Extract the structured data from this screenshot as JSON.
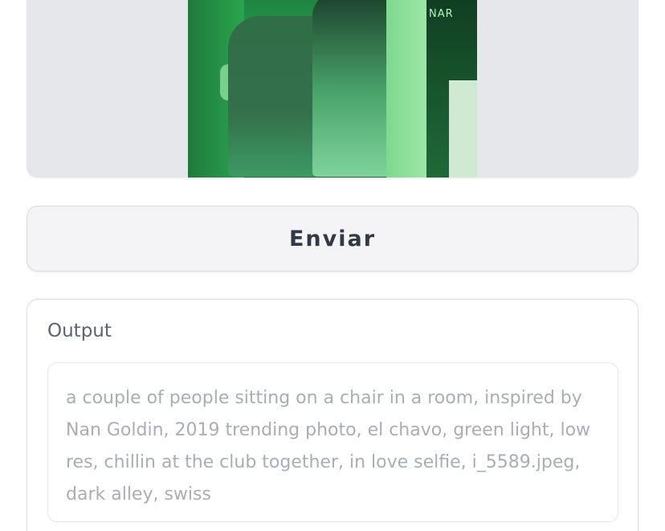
{
  "image": {
    "sign_text": "NAR"
  },
  "submit_button": {
    "label": "Enviar"
  },
  "output": {
    "label": "Output",
    "text": "a couple of people sitting on a chair in a room, inspired by Nan Goldin, 2019 trending photo, el chavo, green light, low res, chillin at the club together, in love selfie, i_5589.jpeg, dark alley, swiss"
  }
}
